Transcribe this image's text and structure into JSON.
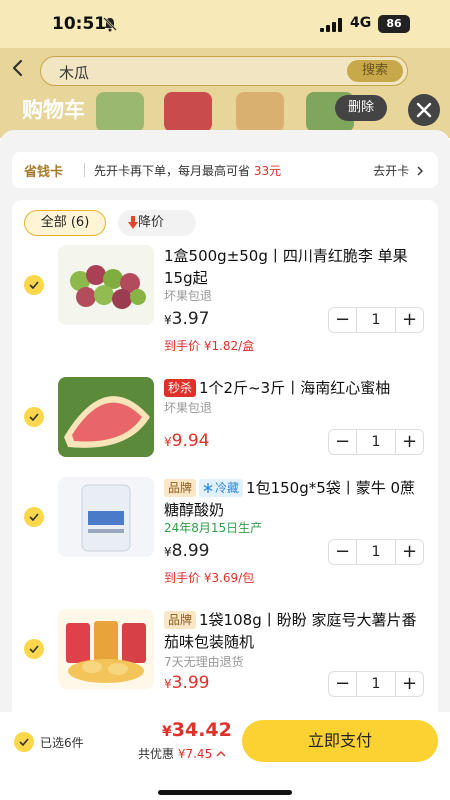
{
  "status_bar": {
    "time": "10:51",
    "network": "4G",
    "battery": "86"
  },
  "search": {
    "query": "木瓜",
    "button": "搜索"
  },
  "cart": {
    "title": "购物车",
    "delete_label": "删除"
  },
  "save_card": {
    "label": "省钱卡",
    "text": "先开卡再下单，每月最高可省",
    "amount": "33元",
    "link": "去开卡"
  },
  "tabs": {
    "all": "全部 (6)",
    "price_drop": "降价"
  },
  "items": [
    {
      "title": "1盒500g±50g丨四川青红脆李 单果15g起",
      "note": "坏果包退",
      "price": "3.97",
      "final_price": "到手价 ¥1.82/盒",
      "qty": "1"
    },
    {
      "tag": "秒杀",
      "title": "1个2斤~3斤丨海南红心蜜柚",
      "note": "坏果包退",
      "price": "9.94",
      "qty": "1"
    },
    {
      "tag": "品牌",
      "tag2": "冷藏",
      "title": "1包150g*5袋丨蒙牛 0蔗糖醇酸奶",
      "note": "24年8月15日生产",
      "price": "8.99",
      "final_price": "到手价 ¥3.69/包",
      "qty": "1"
    },
    {
      "tag": "品牌",
      "title": "1袋108g丨盼盼 家庭号大薯片番茄味包装随机",
      "note": "7天无理由退货",
      "price": "3.99",
      "qty": "1"
    }
  ],
  "footer": {
    "selected": "已选6件",
    "currency": "¥",
    "total": "34.42",
    "discount_label": "共优惠",
    "discount_amount": "¥7.45",
    "pay_label": "立即支付"
  },
  "colors": {
    "accent": "#fcd232",
    "price_red": "#e0302a",
    "check": "#fcd74b"
  },
  "icons": [
    "bell-off-icon",
    "signal-icon",
    "back-arrow-icon",
    "close-icon",
    "arrow-down-icon",
    "checkmark-icon",
    "snowflake-icon",
    "chevron-right-icon",
    "chevron-up-icon",
    "minus-icon",
    "plus-icon"
  ]
}
